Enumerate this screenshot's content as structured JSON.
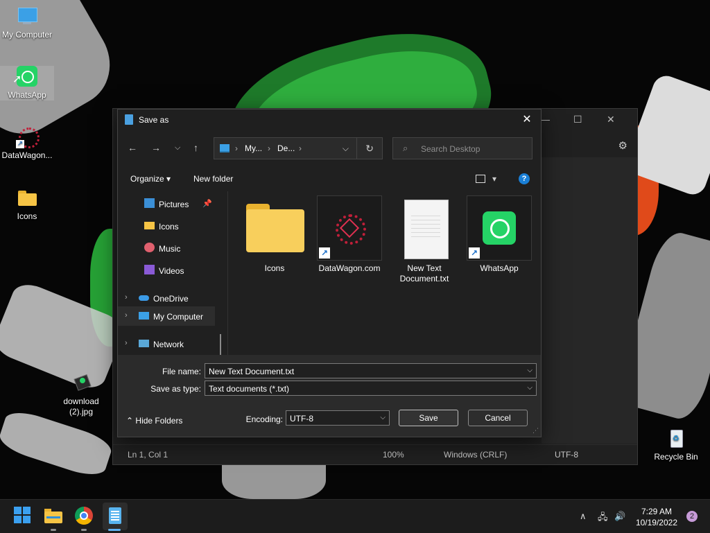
{
  "desktop": {
    "icons": [
      {
        "label": "My Computer"
      },
      {
        "label": "WhatsApp"
      },
      {
        "label": "DataWagon..."
      },
      {
        "label": "Icons"
      },
      {
        "label": "download\n(2).jpg"
      },
      {
        "label": "Recycle Bin"
      }
    ]
  },
  "notepad": {
    "status": {
      "position": "Ln 1, Col 1",
      "zoom": "100%",
      "line_ending": "Windows (CRLF)",
      "encoding": "UTF-8"
    }
  },
  "dialog": {
    "title": "Save as",
    "address": {
      "crumb1": "My...",
      "crumb2": "De..."
    },
    "search_placeholder": "Search Desktop",
    "commands": {
      "organize": "Organize",
      "new_folder": "New folder",
      "help": "?"
    },
    "nav_items": [
      {
        "label": "Pictures"
      },
      {
        "label": "Icons"
      },
      {
        "label": "Music"
      },
      {
        "label": "Videos"
      },
      {
        "label": "OneDrive"
      },
      {
        "label": "My Computer"
      },
      {
        "label": "Network"
      }
    ],
    "files": [
      {
        "name": "Icons"
      },
      {
        "name": "DataWagon.com"
      },
      {
        "name": "New Text Document.txt"
      },
      {
        "name": "WhatsApp"
      }
    ],
    "file_name_label": "File name:",
    "file_name_value": "New Text Document.txt",
    "save_type_label": "Save as type:",
    "save_type_value": "Text documents (*.txt)",
    "encoding_label": "Encoding:",
    "encoding_value": "UTF-8",
    "save_label": "Save",
    "cancel_label": "Cancel",
    "hide_folders_label": "Hide Folders"
  },
  "taskbar": {
    "time": "7:29 AM",
    "date": "10/19/2022",
    "notifications": "2"
  },
  "colors": {
    "accent": "#1a7fd6",
    "whatsapp": "#25d366",
    "folder": "#f6c445"
  }
}
